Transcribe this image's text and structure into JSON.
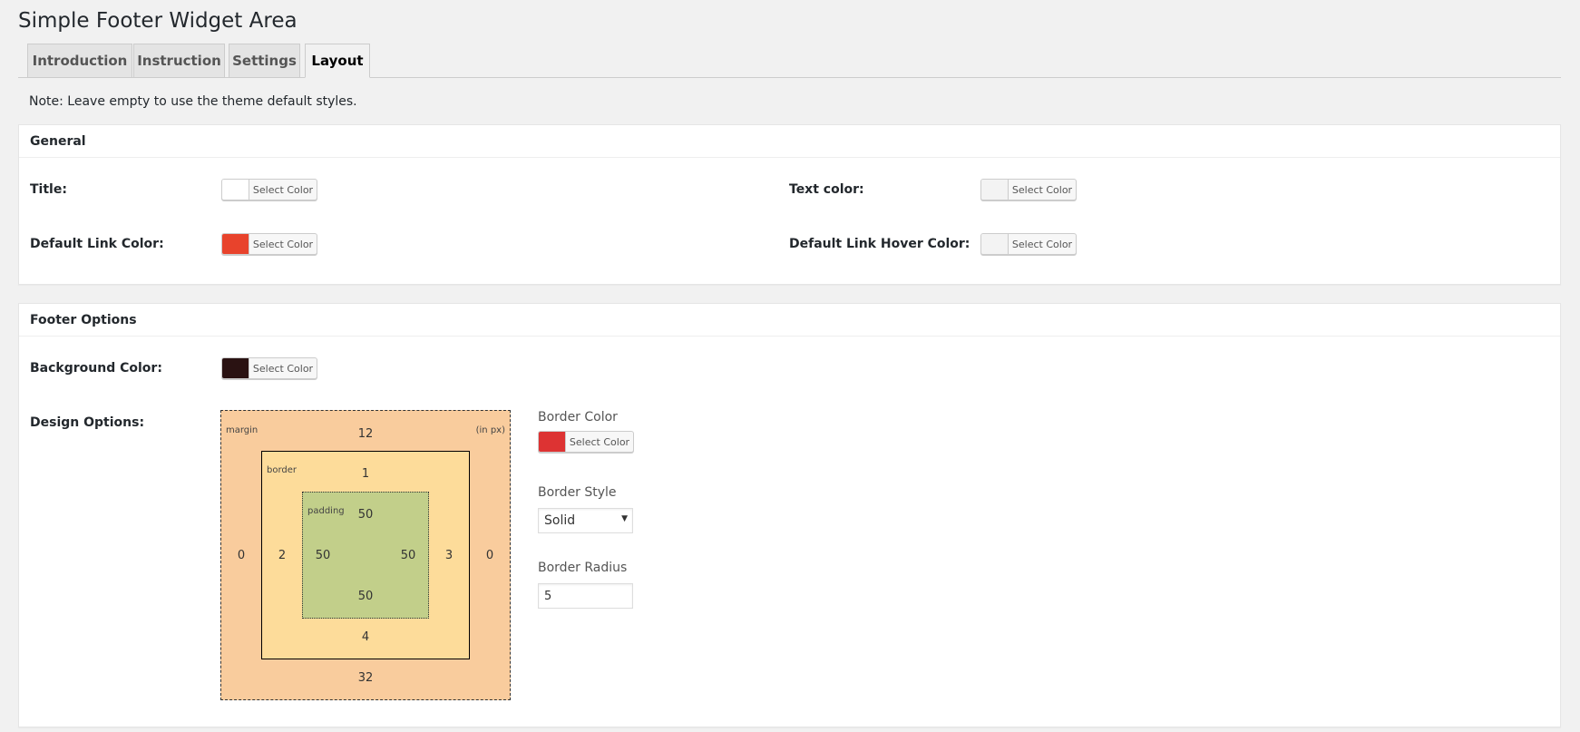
{
  "page": {
    "title": "Simple Footer Widget Area",
    "note": "Note: Leave empty to use the theme default styles."
  },
  "tabs": [
    {
      "label": "Introduction",
      "active": false
    },
    {
      "label": "Instruction",
      "active": false
    },
    {
      "label": "Settings",
      "active": false
    },
    {
      "label": "Layout",
      "active": true
    }
  ],
  "common": {
    "select_color_label": "Select Color"
  },
  "general": {
    "heading": "General",
    "fields": {
      "title": {
        "label": "Title:",
        "color": "#ffffff"
      },
      "text_color": {
        "label": "Text color:",
        "color": "#f3f3f3"
      },
      "link_color": {
        "label": "Default Link Color:",
        "color": "#e8432c"
      },
      "link_hover_color": {
        "label": "Default Link Hover Color:",
        "color": "#f3f3f3"
      }
    }
  },
  "footer_options": {
    "heading": "Footer Options",
    "background": {
      "label": "Background Color:",
      "color": "#2a1212"
    },
    "design_label": "Design Options:",
    "box_model": {
      "margin_label": "margin",
      "unit_label": "(in px)",
      "border_label": "border",
      "padding_label": "padding",
      "margin": {
        "top": "12",
        "right": "0",
        "bottom": "32",
        "left": "0"
      },
      "border": {
        "top": "1",
        "right": "3",
        "bottom": "4",
        "left": "2"
      },
      "padding": {
        "top": "50",
        "right": "50",
        "bottom": "50",
        "left": "50"
      }
    },
    "border_color": {
      "label": "Border Color",
      "color": "#dd3333"
    },
    "border_style": {
      "label": "Border Style",
      "value": "Solid"
    },
    "border_radius": {
      "label": "Border Radius",
      "value": "5"
    }
  }
}
